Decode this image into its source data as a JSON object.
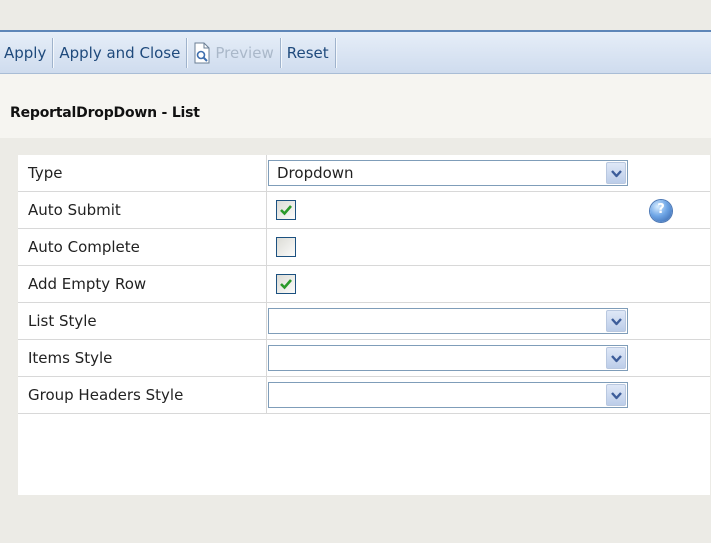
{
  "toolbar": {
    "apply_label": "Apply",
    "apply_close_label": "Apply and Close",
    "preview_label": "Preview",
    "reset_label": "Reset"
  },
  "page": {
    "title": "ReportalDropDown - List"
  },
  "form": {
    "type": {
      "label": "Type",
      "value": "Dropdown"
    },
    "auto_submit": {
      "label": "Auto Submit",
      "checked": true
    },
    "auto_complete": {
      "label": "Auto Complete",
      "checked": false
    },
    "add_empty_row": {
      "label": "Add Empty Row",
      "checked": true
    },
    "list_style": {
      "label": "List Style",
      "value": ""
    },
    "items_style": {
      "label": "Items Style",
      "value": ""
    },
    "group_headers_style": {
      "label": "Group Headers Style",
      "value": ""
    }
  },
  "icons": {
    "help": "help-icon",
    "preview": "preview-icon",
    "dropdown_arrow": "chevron-down-icon"
  },
  "colors": {
    "toolbar_text": "#1f4a7c",
    "check_mark": "#2a9a2a",
    "field_border": "#7f9db9"
  }
}
